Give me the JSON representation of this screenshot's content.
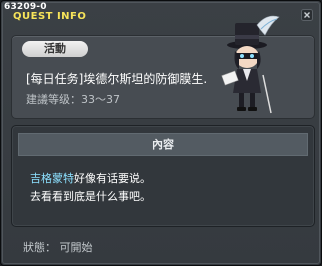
{
  "header": {
    "quest_id": "63209-0",
    "title": "QUEST INFO"
  },
  "quest": {
    "category_tab": "活動",
    "name": "[每日任务]埃德尔斯坦的防御膜生.",
    "level_label": "建議等级：",
    "level_range": "33～37"
  },
  "content": {
    "header": "內容",
    "npc_name": "吉格蒙特",
    "line1_rest": "好像有话要说。",
    "line2": "去看看到底是什么事吧。"
  },
  "status": {
    "text": "狀態：  可開始"
  },
  "colors": {
    "title": "#f7e45a",
    "npc_highlight": "#8ce0ff",
    "window_bg": "#3b4045"
  }
}
